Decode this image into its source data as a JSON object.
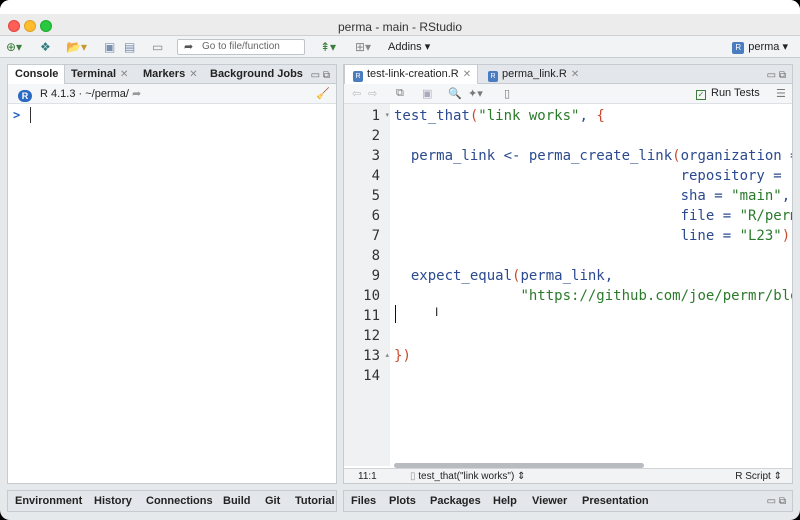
{
  "window": {
    "title": "perma - main - RStudio"
  },
  "toolbar": {
    "goto_placeholder": "Go to file/function",
    "addins_label": "Addins",
    "project_label": "perma"
  },
  "left_pane": {
    "tabs": [
      "Console",
      "Terminal",
      "Markers",
      "Background Jobs"
    ],
    "r_version": "R 4.1.3",
    "working_dir": "~/perma/",
    "prompt": ">"
  },
  "left_bottom_tabs": [
    "Environment",
    "History",
    "Connections",
    "Build",
    "Git",
    "Tutorial"
  ],
  "editor": {
    "tabs": [
      "test-link-creation.R",
      "perma_link.R"
    ],
    "run_tests_label": "Run Tests",
    "lines": [
      "test_that(\"link works\", {",
      "",
      "  perma_link <- perma_create_link(organization =",
      "                                  repository = \"",
      "                                  sha = \"main\",",
      "                                  file = \"R/perm",
      "                                  line = \"L23\")",
      "",
      "  expect_equal(perma_link,",
      "               \"https://github.com/joe/permr/blo",
      "",
      "",
      "})",
      ""
    ],
    "line_numbers": [
      "1",
      "2",
      "3",
      "4",
      "5",
      "6",
      "7",
      "8",
      "9",
      "10",
      "11",
      "12",
      "13",
      "14"
    ]
  },
  "status": {
    "position": "11:1",
    "function": "test_that(\"link works\")",
    "file_type": "R Script"
  },
  "right_bottom_tabs": [
    "Files",
    "Plots",
    "Packages",
    "Help",
    "Viewer",
    "Presentation"
  ]
}
